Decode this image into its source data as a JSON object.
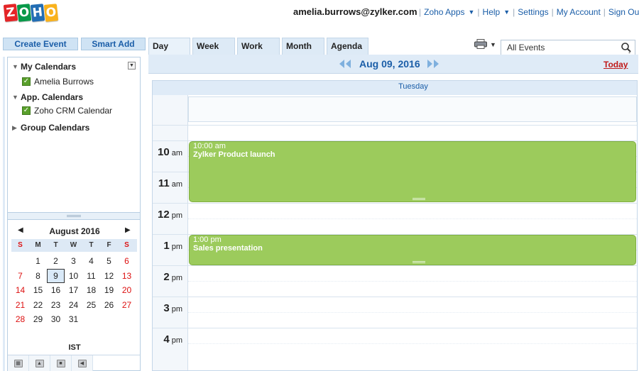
{
  "logo": {
    "letters": [
      "Z",
      "O",
      "H",
      "O"
    ],
    "colors": [
      "#e42527",
      "#089949",
      "#226db4",
      "#f9b21d"
    ]
  },
  "header": {
    "user_email": "amelia.burrows@zylker.com",
    "nav": {
      "zoho_apps": "Zoho Apps",
      "help": "Help",
      "settings": "Settings",
      "my_account": "My Account",
      "sign_out": "Sign Out"
    }
  },
  "sidebar": {
    "create_event": "Create Event",
    "smart_add": "Smart Add",
    "groups": {
      "my_calendars": "My Calendars",
      "app_calendars": "App. Calendars",
      "group_calendars": "Group Calendars"
    },
    "calendars": {
      "amelia": "Amelia Burrows",
      "crm": "Zoho CRM Calendar"
    },
    "check_color": "#5aa02c"
  },
  "mini_calendar": {
    "title": "August 2016",
    "weekdays": [
      "S",
      "M",
      "T",
      "W",
      "T",
      "F",
      "S"
    ],
    "days": [
      "",
      "1",
      "2",
      "3",
      "4",
      "5",
      "6",
      "7",
      "8",
      "9",
      "10",
      "11",
      "12",
      "13",
      "14",
      "15",
      "16",
      "17",
      "18",
      "19",
      "20",
      "21",
      "22",
      "23",
      "24",
      "25",
      "26",
      "27",
      "28",
      "29",
      "30",
      "31",
      "",
      "",
      ""
    ],
    "selected_day": "9",
    "timezone": "IST"
  },
  "tabs": {
    "day": "Day",
    "week": "Week",
    "work": "Work",
    "month": "Month",
    "agenda": "Agenda",
    "active": "Day"
  },
  "search": {
    "value": "All Events"
  },
  "date_nav": {
    "title": "Aug 09, 2016",
    "today": "Today"
  },
  "day_view": {
    "weekday": "Tuesday",
    "hours": [
      {
        "num": "10",
        "ampm": "am"
      },
      {
        "num": "11",
        "ampm": "am"
      },
      {
        "num": "12",
        "ampm": "pm"
      },
      {
        "num": "1",
        "ampm": "pm"
      },
      {
        "num": "2",
        "ampm": "pm"
      },
      {
        "num": "3",
        "ampm": "pm"
      },
      {
        "num": "4",
        "ampm": "pm"
      }
    ],
    "events": [
      {
        "time": "10:00 am",
        "title": "Zylker Product launch",
        "color": "#9ccb5c"
      },
      {
        "time": "1:00 pm",
        "title": "Sales presentation",
        "color": "#9ccb5c"
      }
    ]
  },
  "colors": {
    "accent_blue": "#1b5ea8",
    "weekend_red": "#d11111",
    "panel_bg": "#dfebf7",
    "event_green": "#9ccb5c"
  }
}
